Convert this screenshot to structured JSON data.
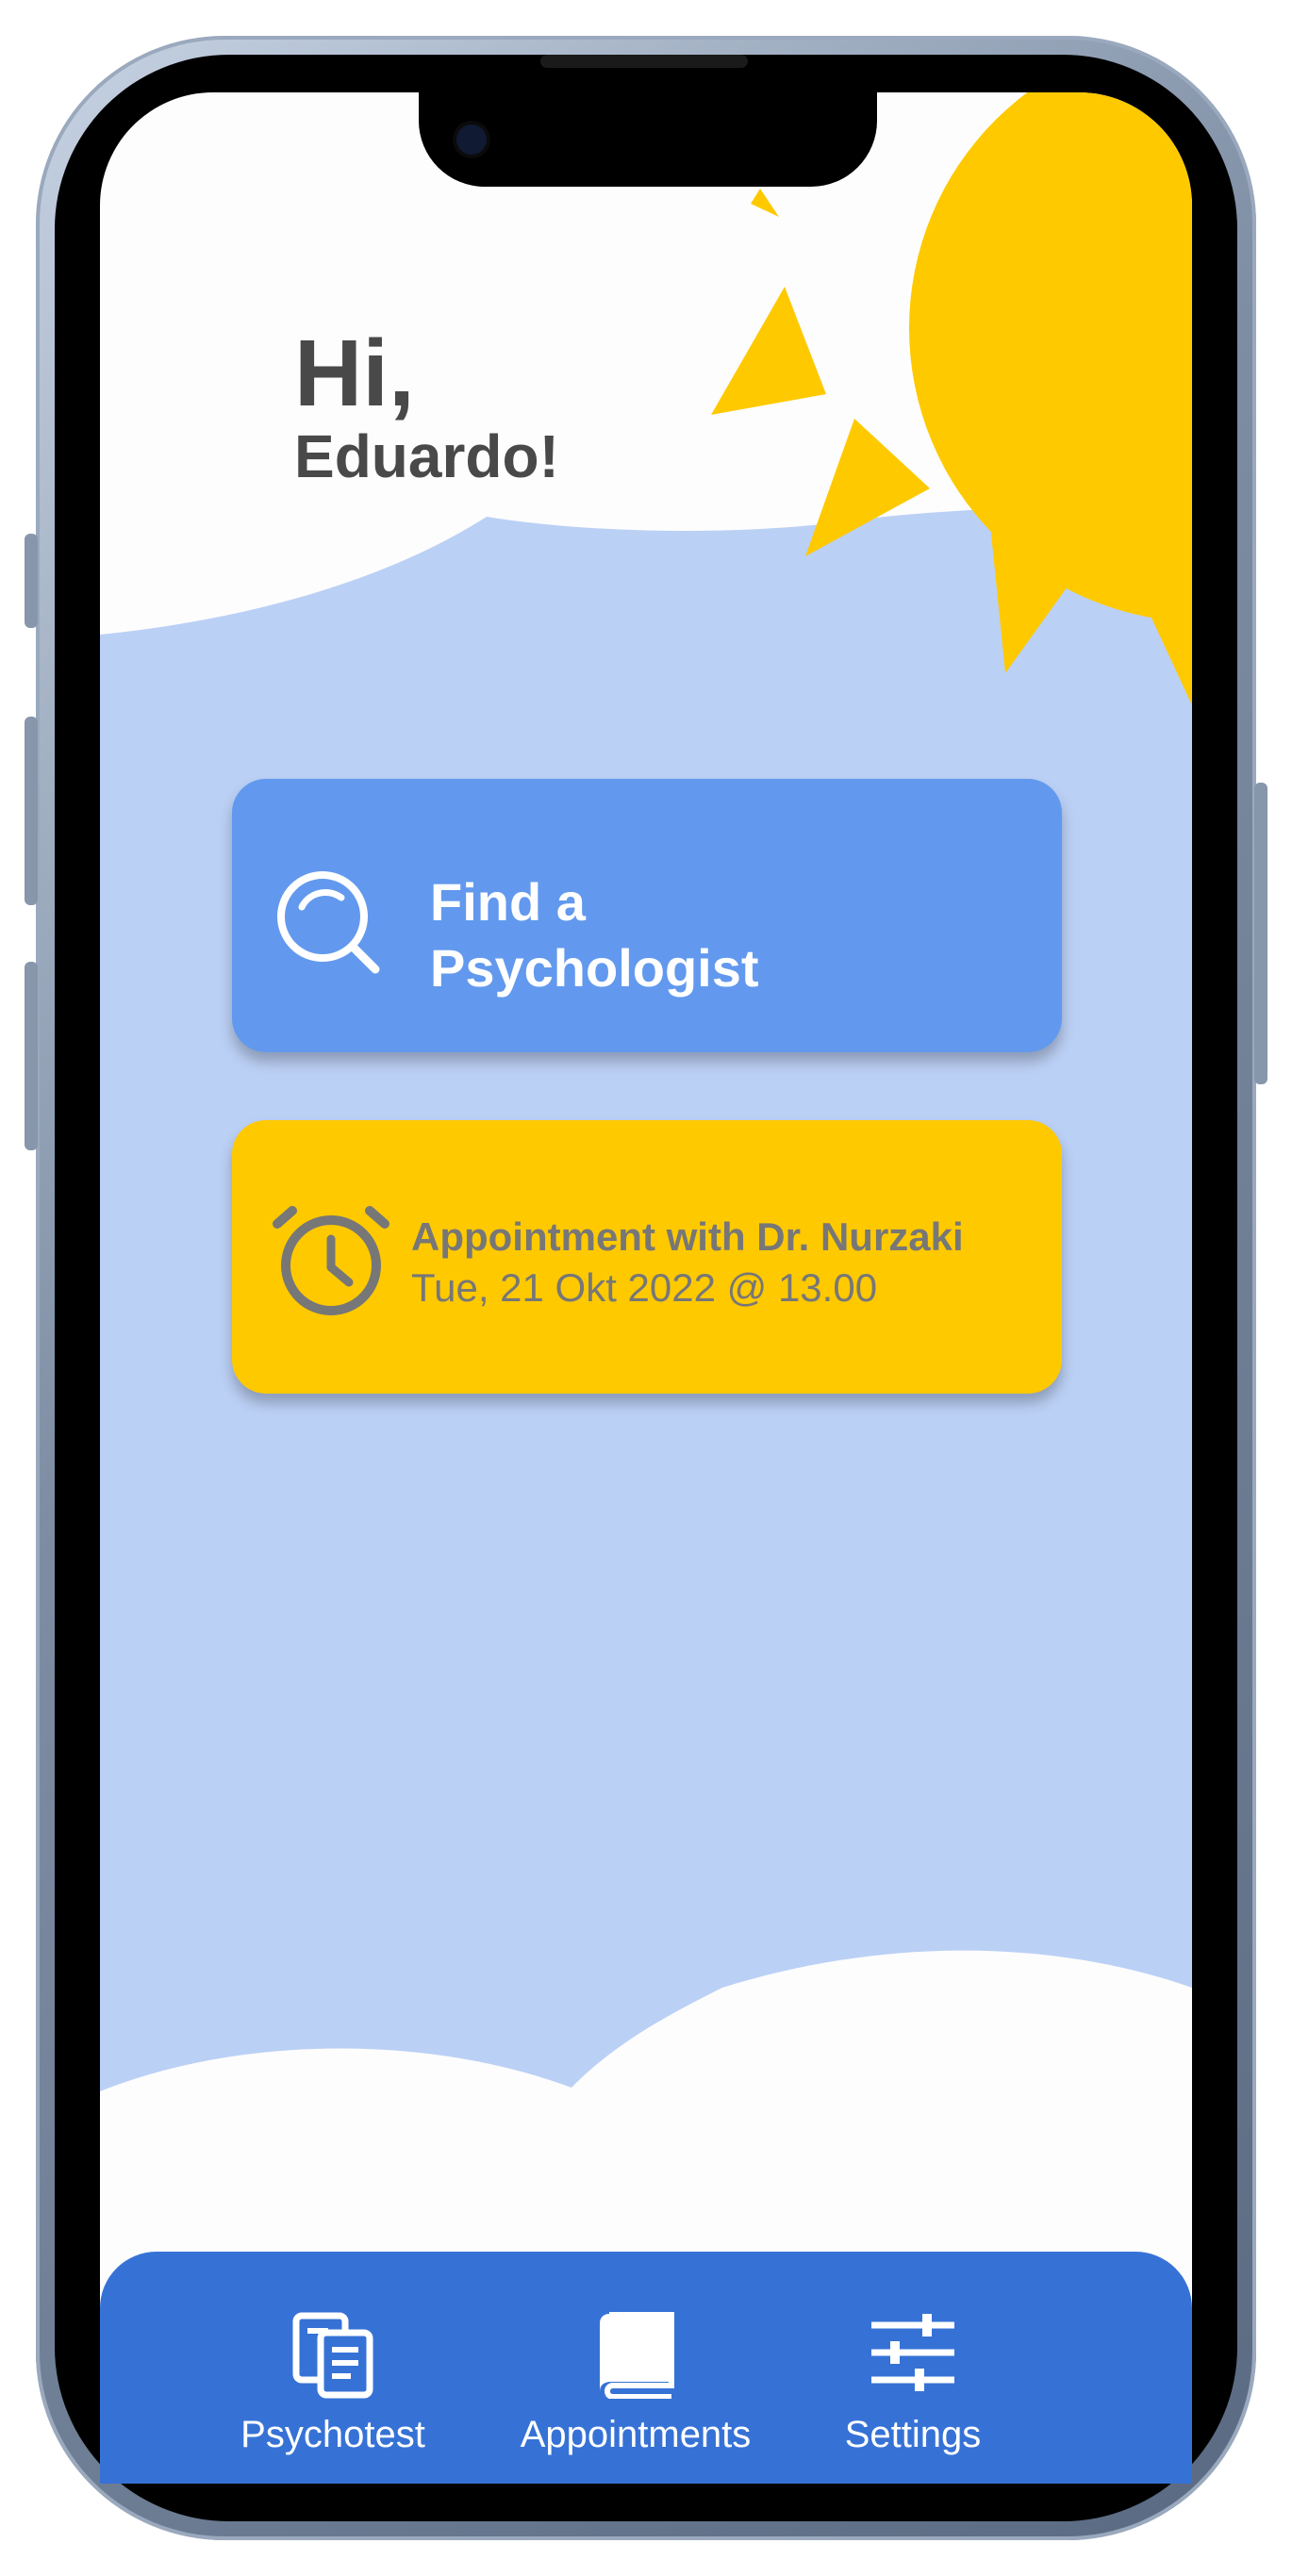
{
  "greeting": {
    "hi": "Hi,",
    "name": "Eduardo!"
  },
  "cards": {
    "find": {
      "line1": "Find a",
      "line2": "Psychologist",
      "icon": "search-icon"
    },
    "appointment": {
      "title": "Appointment with Dr. Nurzaki",
      "when": "Tue, 21 Okt 2022 @ 13.00",
      "icon": "alarm-clock-icon"
    }
  },
  "tabs": [
    {
      "label": "Psychotest",
      "icon": "document-list-icon"
    },
    {
      "label": "Appointments",
      "icon": "book-icon"
    },
    {
      "label": "Settings",
      "icon": "sliders-icon"
    }
  ],
  "colors": {
    "sky": "#bbd0f5",
    "sun": "#ffc900",
    "primary_card": "#6299ee",
    "tabbar": "#3672d6",
    "greeting_text": "#494949"
  }
}
